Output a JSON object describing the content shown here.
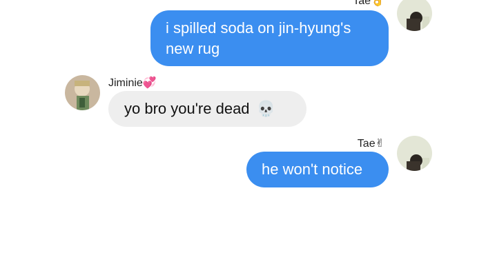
{
  "messages": [
    {
      "sender": "Tae",
      "sender_emoji": "👌",
      "direction": "outgoing",
      "text_line1": "i spilled soda on jin-hyung's",
      "text_line2": "new rug"
    },
    {
      "sender": "Jiminie",
      "sender_emoji": "💞",
      "direction": "incoming",
      "text": "yo bro you're dead",
      "text_emoji": "💀"
    },
    {
      "sender": "Tae",
      "sender_emoji": "✌",
      "direction": "outgoing",
      "text": "he won't notice"
    }
  ],
  "colors": {
    "outgoing_bubble": "#3b8ef0",
    "incoming_bubble": "#eeeeee",
    "background": "#ffffff"
  }
}
